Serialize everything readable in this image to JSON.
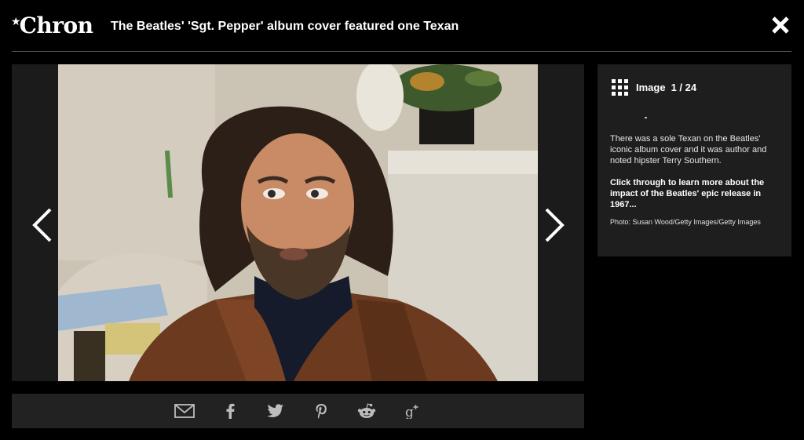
{
  "header": {
    "logo_text": "Chron",
    "title": "The Beatles' 'Sgt. Pepper' album cover featured one Texan",
    "close_icon": "close-icon"
  },
  "gallery": {
    "image_label": "Image",
    "image_counter": "1 / 24",
    "photo_alt": "Terry Southern"
  },
  "caption": {
    "text": "There was a sole Texan on the Beatles' iconic album cover and it was author and noted hipster Terry Southern.",
    "cta": "Click through to learn more about the impact of the Beatles' epic release in 1967...",
    "credit": "Photo: Susan Wood/Getty Images/Getty Images"
  },
  "share": {
    "items": [
      "email-icon",
      "facebook-icon",
      "twitter-icon",
      "pinterest-icon",
      "reddit-icon",
      "google-plus-icon"
    ]
  },
  "colors": {
    "background": "#000000",
    "panel": "#1e1e1e",
    "share_bar": "#222222",
    "divider": "#5a5a5a"
  }
}
